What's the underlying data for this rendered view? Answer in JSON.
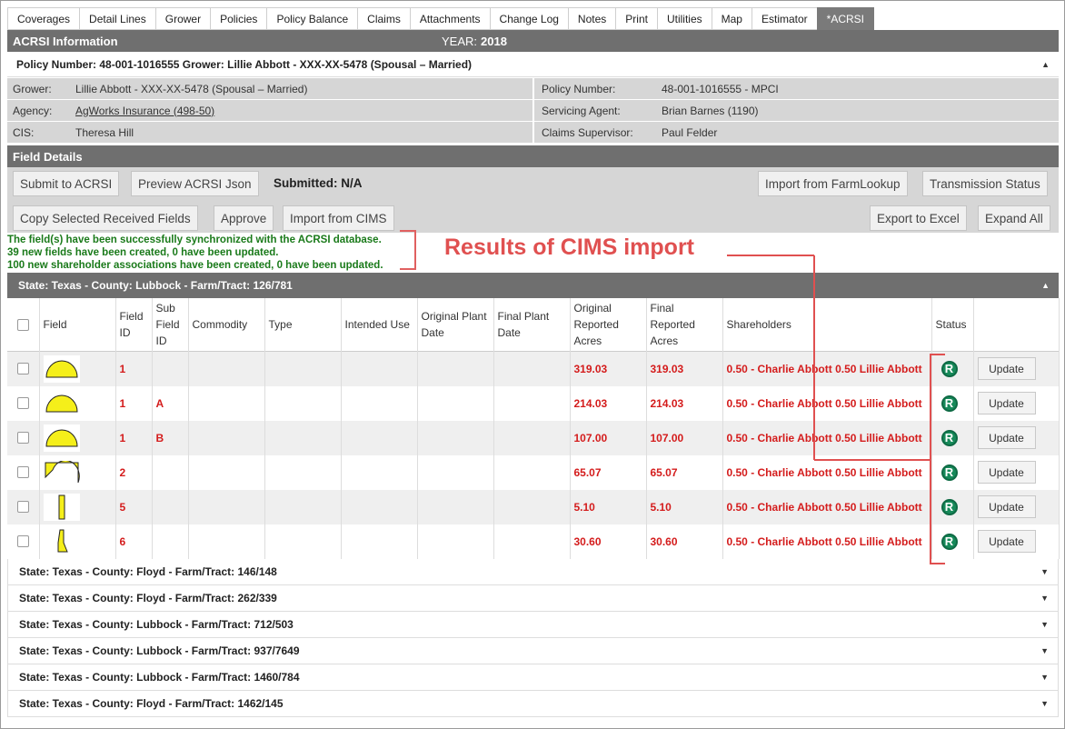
{
  "tabs": [
    "Coverages",
    "Detail Lines",
    "Grower",
    "Policies",
    "Policy Balance",
    "Claims",
    "Attachments",
    "Change Log",
    "Notes",
    "Print",
    "Utilities",
    "Map",
    "Estimator",
    "*ACRSI"
  ],
  "header": {
    "title": "ACRSI Information",
    "year_label": "YEAR:",
    "year": "2018"
  },
  "policy_line": "Policy Number: 48-001-1016555 Grower: Lillie Abbott - XXX-XX-5478 (Spousal – Married)",
  "info": {
    "grower_label": "Grower:",
    "grower": "Lillie Abbott - XXX-XX-5478 (Spousal – Married)",
    "agency_label": "Agency:",
    "agency": "AgWorks Insurance (498-50)",
    "cis_label": "CIS:",
    "cis": "Theresa Hill",
    "policy_label": "Policy Number:",
    "policy": "48-001-1016555 - MPCI",
    "agent_label": "Servicing Agent:",
    "agent": "Brian Barnes (1190)",
    "supervisor_label": "Claims Supervisor:",
    "supervisor": "Paul Felder"
  },
  "field_details": {
    "title": "Field Details",
    "buttons": {
      "submit": "Submit to ACRSI",
      "preview": "Preview ACRSI Json",
      "import_farm": "Import from FarmLookup",
      "transmission": "Transmission Status",
      "copy": "Copy Selected Received Fields",
      "approve": "Approve",
      "import_cims": "Import from CIMS",
      "export": "Export to Excel",
      "expand": "Expand All"
    },
    "submitted_label": "Submitted:",
    "submitted_value": "N/A"
  },
  "messages": [
    "The field(s) have been successfully synchronized with the ACRSI database.",
    "39 new fields have been created, 0 have been updated.",
    "100 new shareholder associations have been created, 0 have been updated."
  ],
  "annotation": "Results of CIMS import",
  "open_group": "State: Texas - County: Lubbock - Farm/Tract: 126/781",
  "columns": {
    "field": "Field",
    "field_id": "Field ID",
    "sub_field_id": "Sub Field ID",
    "commodity": "Commodity",
    "type": "Type",
    "intended_use": "Intended Use",
    "original_plant_date": "Original Plant Date",
    "final_plant_date": "Final Plant Date",
    "original_reported_acres": "Original Reported Acres",
    "final_reported_acres": "Final Reported Acres",
    "shareholders": "Shareholders",
    "status": "Status"
  },
  "rows": [
    {
      "shape": "half-dome",
      "field_id": "1",
      "sub": "",
      "orig": "319.03",
      "final": "319.03",
      "share": "0.50 - Charlie Abbott 0.50 Lillie Abbott",
      "status": "R",
      "action": "Update"
    },
    {
      "shape": "half-dome",
      "field_id": "1",
      "sub": "A",
      "orig": "214.03",
      "final": "214.03",
      "share": "0.50 - Charlie Abbott 0.50 Lillie Abbott",
      "status": "R",
      "action": "Update"
    },
    {
      "shape": "half-dome",
      "field_id": "1",
      "sub": "B",
      "orig": "107.00",
      "final": "107.00",
      "share": "0.50 - Charlie Abbott 0.50 Lillie Abbott",
      "status": "R",
      "action": "Update"
    },
    {
      "shape": "arch",
      "field_id": "2",
      "sub": "",
      "orig": "65.07",
      "final": "65.07",
      "share": "0.50 - Charlie Abbott 0.50 Lillie Abbott",
      "status": "R",
      "action": "Update"
    },
    {
      "shape": "strip",
      "field_id": "5",
      "sub": "",
      "orig": "5.10",
      "final": "5.10",
      "share": "0.50 - Charlie Abbott 0.50 Lillie Abbott",
      "status": "R",
      "action": "Update"
    },
    {
      "shape": "boot",
      "field_id": "6",
      "sub": "",
      "orig": "30.60",
      "final": "30.60",
      "share": "0.50 - Charlie Abbott 0.50 Lillie Abbott",
      "status": "R",
      "action": "Update"
    }
  ],
  "collapsed_groups": [
    "State: Texas - County: Floyd - Farm/Tract: 146/148",
    "State: Texas - County: Floyd - Farm/Tract: 262/339",
    "State: Texas - County: Lubbock - Farm/Tract: 712/503",
    "State: Texas - County: Lubbock - Farm/Tract: 937/7649",
    "State: Texas - County: Lubbock - Farm/Tract: 1460/784",
    "State: Texas - County: Floyd - Farm/Tract: 1462/145"
  ],
  "colors": {
    "header_bar": "#6f6f6f",
    "info_bg": "#d6d6d6",
    "success": "#1a7a1a",
    "error_red": "#d41c1c",
    "annotation": "#e05050",
    "status_green": "#178a5a",
    "field_shape": "#f5ef1a"
  }
}
